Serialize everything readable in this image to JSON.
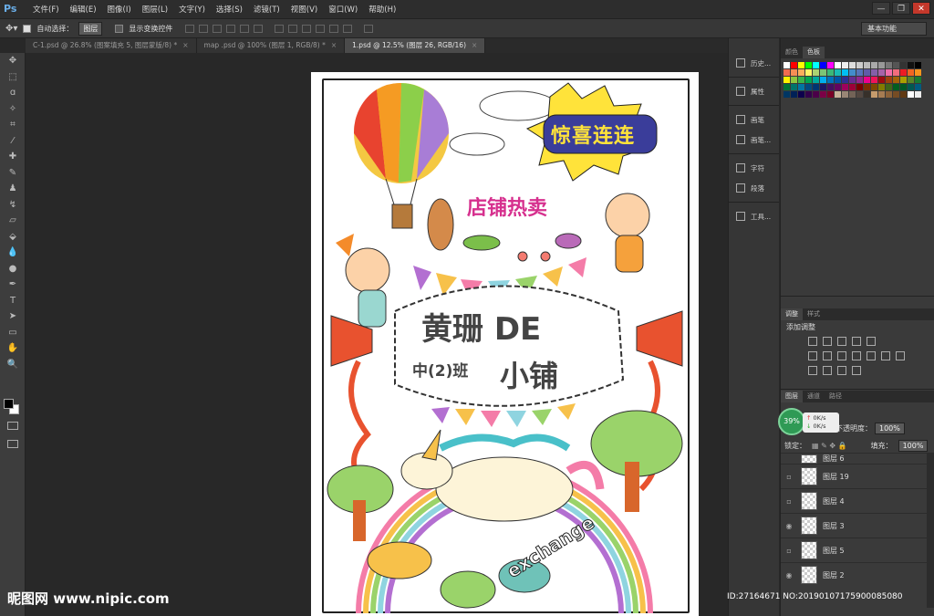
{
  "app": {
    "logo": "Ps"
  },
  "menu": [
    "文件(F)",
    "编辑(E)",
    "图像(I)",
    "图层(L)",
    "文字(Y)",
    "选择(S)",
    "滤镜(T)",
    "视图(V)",
    "窗口(W)",
    "帮助(H)"
  ],
  "window_buttons": [
    "—",
    "❐",
    "✕"
  ],
  "options": {
    "auto_select_label": "自动选择：",
    "auto_select_value": "图层",
    "show_transform_label": "显示变换控件"
  },
  "workspace": "基本功能",
  "tabs": [
    {
      "label": "C-1.psd @ 26.8% (图案填充 5, 图层蒙版/8) *",
      "active": false
    },
    {
      "label": "map .psd @ 100% (图层 1, RGB/8) *",
      "active": false
    },
    {
      "label": "1.psd @ 12.5% (图层 26, RGB/16)",
      "active": true
    }
  ],
  "side_panels": [
    {
      "label": "历史..."
    },
    {
      "label": "属性"
    },
    {
      "label": "画笔"
    },
    {
      "label": "画笔..."
    },
    {
      "label": "字符"
    },
    {
      "label": "段落"
    },
    {
      "label": "工具..."
    }
  ],
  "swatches": {
    "tabs": [
      "颜色",
      "色板"
    ],
    "colors": [
      "#ffffff",
      "#ff0000",
      "#ffff00",
      "#00ff00",
      "#00ffff",
      "#0000ff",
      "#ff00ff",
      "#ffffff",
      "#eeeeee",
      "#dddddd",
      "#cccccc",
      "#bbbbbb",
      "#aaaaaa",
      "#999999",
      "#777777",
      "#555555",
      "#333333",
      "#111111",
      "#000000",
      "#f26c4f",
      "#f68e55",
      "#fbaf5c",
      "#fff467",
      "#acd372",
      "#7cc576",
      "#3bb878",
      "#1abbb4",
      "#00bff3",
      "#438ccb",
      "#5574b9",
      "#605ca8",
      "#855fa8",
      "#a763a8",
      "#f06eaa",
      "#f26d7d",
      "#ed1c24",
      "#f26522",
      "#f7941d",
      "#fff200",
      "#8dc63f",
      "#39b54a",
      "#00a651",
      "#00a99d",
      "#00aeef",
      "#0072bc",
      "#0054a6",
      "#2e3192",
      "#662d91",
      "#92278f",
      "#ec008c",
      "#ed145b",
      "#9e0b0f",
      "#a0410d",
      "#a3620a",
      "#aba000",
      "#598527",
      "#1a7b30",
      "#007236",
      "#00746b",
      "#0076a3",
      "#004b80",
      "#003471",
      "#1b1464",
      "#440e62",
      "#630460",
      "#9e005d",
      "#9e0039",
      "#790000",
      "#7b2e00",
      "#7d4900",
      "#827b00",
      "#406618",
      "#005e20",
      "#005826",
      "#005952",
      "#005b7f",
      "#003663",
      "#002157",
      "#0d004c",
      "#32004b",
      "#4b0049",
      "#7b0046",
      "#7a0026",
      "#c7b299",
      "#998675",
      "#736357",
      "#534741",
      "#37302a",
      "#c69c6d",
      "#a67c52",
      "#8c6239",
      "#754c24",
      "#603913",
      "#ffffff",
      "#eeeeee"
    ]
  },
  "adjustments": {
    "tabs": [
      "调整",
      "样式"
    ],
    "title": "添加调整"
  },
  "layers": {
    "tabs": [
      "图层",
      "通道",
      "路径"
    ],
    "opacity_label": "不透明度：",
    "opacity": "100%",
    "lock_label": "锁定：",
    "fill_label": "填充：",
    "fill": "100%",
    "items": [
      {
        "name": "图层 6",
        "visible": false
      },
      {
        "name": "图层 19",
        "visible": false
      },
      {
        "name": "图层 4",
        "visible": false
      },
      {
        "name": "图层 3",
        "visible": true
      },
      {
        "name": "图层 5",
        "visible": false
      },
      {
        "name": "图层 2",
        "visible": true
      }
    ]
  },
  "network": {
    "percent": "39%",
    "up": "0K/s",
    "down": "0K/s"
  },
  "artwork": {
    "banner": "惊喜连连",
    "shop_hot": "店铺热卖",
    "title_main": "黄珊 DE",
    "class_name": "中(2)班",
    "shop": "小铺",
    "exchange": "exchange"
  },
  "watermark": {
    "left": "昵图网 www.nipic.com",
    "right": "ID:27164671 NO:20190107175900085080"
  }
}
